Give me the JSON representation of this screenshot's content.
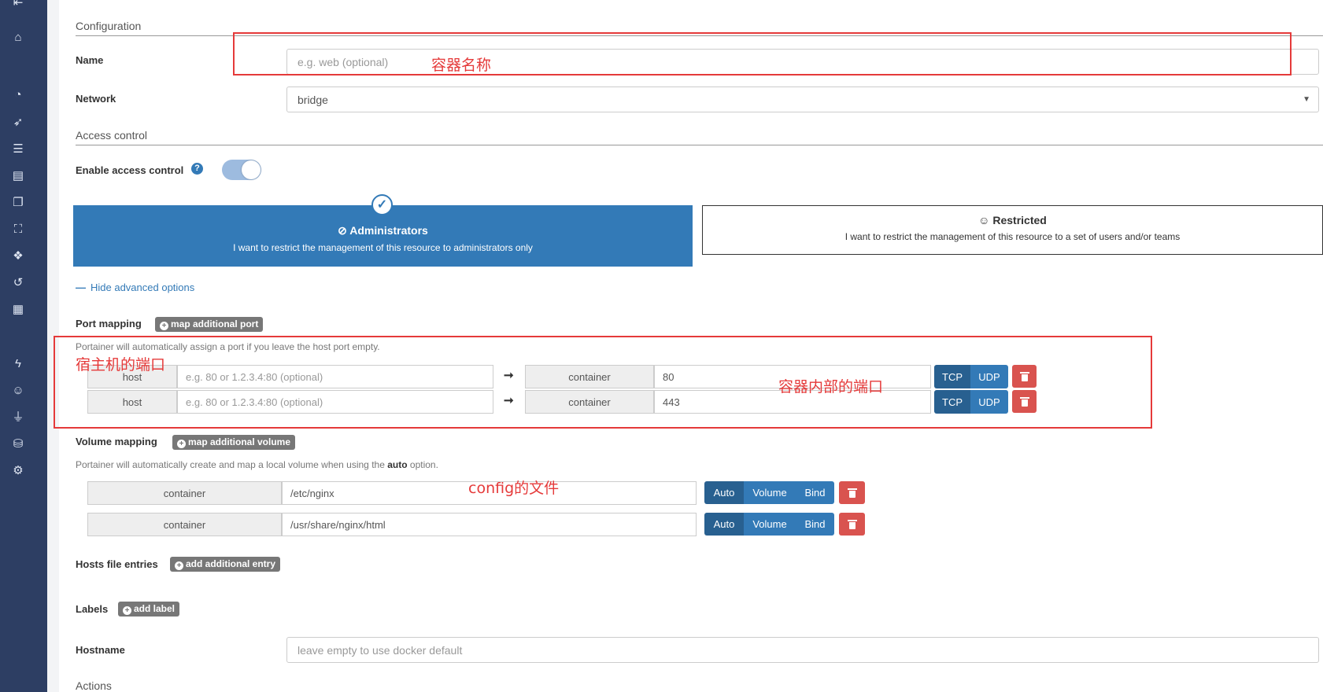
{
  "sidebar": {
    "icons": [
      "arrow-left-icon",
      "home-icon",
      "dashboard-icon",
      "rocket-icon",
      "list-icon",
      "server-icon",
      "images-icon",
      "network-icon",
      "cubes-icon",
      "history-icon",
      "grid-icon",
      "bolt-icon",
      "users-icon",
      "plug-icon",
      "database-icon",
      "cogs-icon"
    ]
  },
  "configuration": {
    "title": "Configuration",
    "name_label": "Name",
    "name_placeholder": "e.g. web (optional)",
    "network_label": "Network",
    "network_value": "bridge"
  },
  "access_control": {
    "title": "Access control",
    "enable_label": "Enable access control",
    "enabled": true,
    "admin_title": "Administrators",
    "admin_desc": "I want to restrict the management of this resource to administrators only",
    "restricted_title": "Restricted",
    "restricted_desc": "I want to restrict the management of this resource to a set of users and/or teams",
    "selected": "Administrators"
  },
  "advanced": {
    "toggle_label": "Hide advanced options"
  },
  "port_mapping": {
    "label": "Port mapping",
    "add_button": "map additional port",
    "help": "Portainer will automatically assign a port if you leave the host port empty.",
    "rows": [
      {
        "host_label": "host",
        "host_placeholder": "e.g. 80 or 1.2.3.4:80 (optional)",
        "container_label": "container",
        "container_value": "80",
        "tcp": "TCP",
        "udp": "UDP"
      },
      {
        "host_label": "host",
        "host_placeholder": "e.g. 80 or 1.2.3.4:80 (optional)",
        "container_label": "container",
        "container_value": "443",
        "tcp": "TCP",
        "udp": "UDP"
      }
    ]
  },
  "volume_mapping": {
    "label": "Volume mapping",
    "add_button": "map additional volume",
    "help_prefix": "Portainer will automatically create and map a local volume when using the ",
    "help_bold": "auto",
    "help_suffix": " option.",
    "rows": [
      {
        "container_label": "container",
        "path": "/etc/nginx",
        "auto": "Auto",
        "volume": "Volume",
        "bind": "Bind"
      },
      {
        "container_label": "container",
        "path": "/usr/share/nginx/html",
        "auto": "Auto",
        "volume": "Volume",
        "bind": "Bind"
      }
    ]
  },
  "hosts": {
    "label": "Hosts file entries",
    "add_button": "add additional entry"
  },
  "labels": {
    "label": "Labels",
    "add_button": "add label"
  },
  "hostname": {
    "label": "Hostname",
    "placeholder": "leave empty to use docker default"
  },
  "actions": {
    "title": "Actions"
  },
  "annotations": {
    "name": "容器名称",
    "host_port": "宿主机的端口",
    "container_port": "容器内部的端口",
    "config": "config的文件"
  }
}
